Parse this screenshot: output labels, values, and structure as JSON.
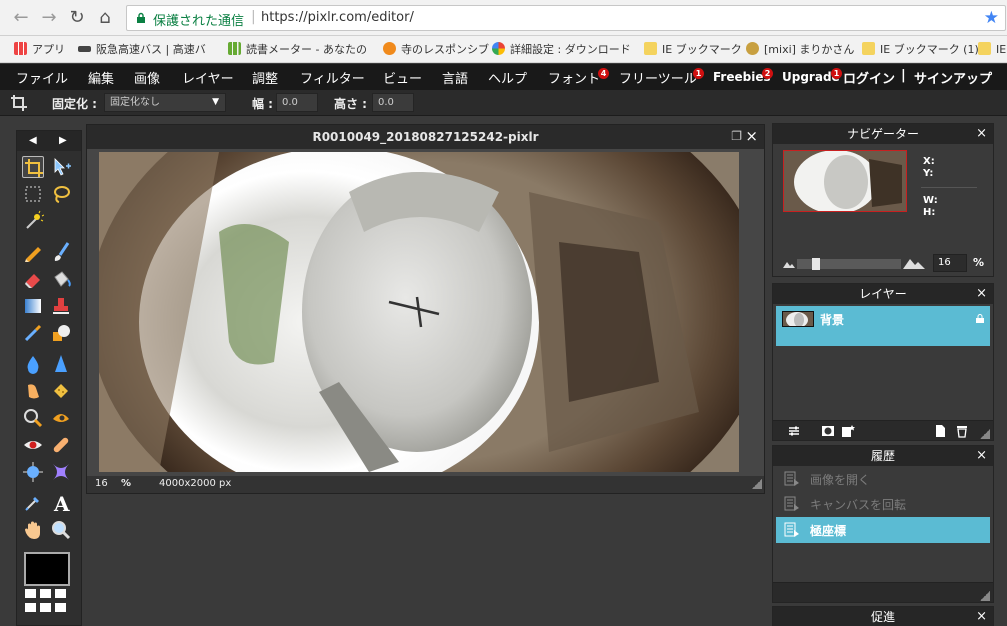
{
  "browser": {
    "security_text": "保護された通信",
    "url": "https://pixlr.com/editor/",
    "bookmarks": [
      "アプリ",
      "阪急高速バス | 高速バ",
      "読書メーター - あなたの",
      "寺のレスポンシブ",
      "詳細設定 : ダウンロード",
      "IE ブックマーク",
      "[mixi] まりかさん",
      "IE ブックマーク (1)",
      "IE"
    ]
  },
  "menu": {
    "items": [
      "ファイル",
      "編集",
      "画像",
      "レイヤー",
      "調整",
      "フィルター",
      "ビュー",
      "言語",
      "ヘルプ",
      "フォント",
      "フリーツール",
      "Freebies",
      "Upgrade"
    ],
    "badges": {
      "font": "4",
      "freetool": "1",
      "freebies": "2",
      "upgrade": "1"
    },
    "login": "ログイン",
    "divider": "|",
    "signup": "サインアップ"
  },
  "options": {
    "constrain_label": "固定化 :",
    "constrain_value": "固定化なし",
    "width_label": "幅 :",
    "width_value": "0.0",
    "height_label": "高さ :",
    "height_value": "0.0"
  },
  "canvas": {
    "title": "R0010049_20180827125242-pixlr",
    "zoom": "16",
    "zoom_unit": "%",
    "dimensions": "4000x2000 px"
  },
  "navigator": {
    "title": "ナビゲーター",
    "x_label": "X:",
    "y_label": "Y:",
    "w_label": "W:",
    "h_label": "H:",
    "zoom_value": "16",
    "zoom_unit": "%",
    "zoom_level": 0.16
  },
  "layers": {
    "title": "レイヤー",
    "items": [
      {
        "name": "背景"
      }
    ]
  },
  "history": {
    "title": "履歴",
    "items": [
      {
        "label": "画像を開く"
      },
      {
        "label": "キャンバスを回転"
      },
      {
        "label": "極座標"
      }
    ]
  },
  "adjust_panel": {
    "title": "促進"
  },
  "colors": {
    "accent": "#5bbbd3",
    "menubar": "#191919",
    "panel": "#3a3a3a",
    "badge": "#d01010"
  }
}
